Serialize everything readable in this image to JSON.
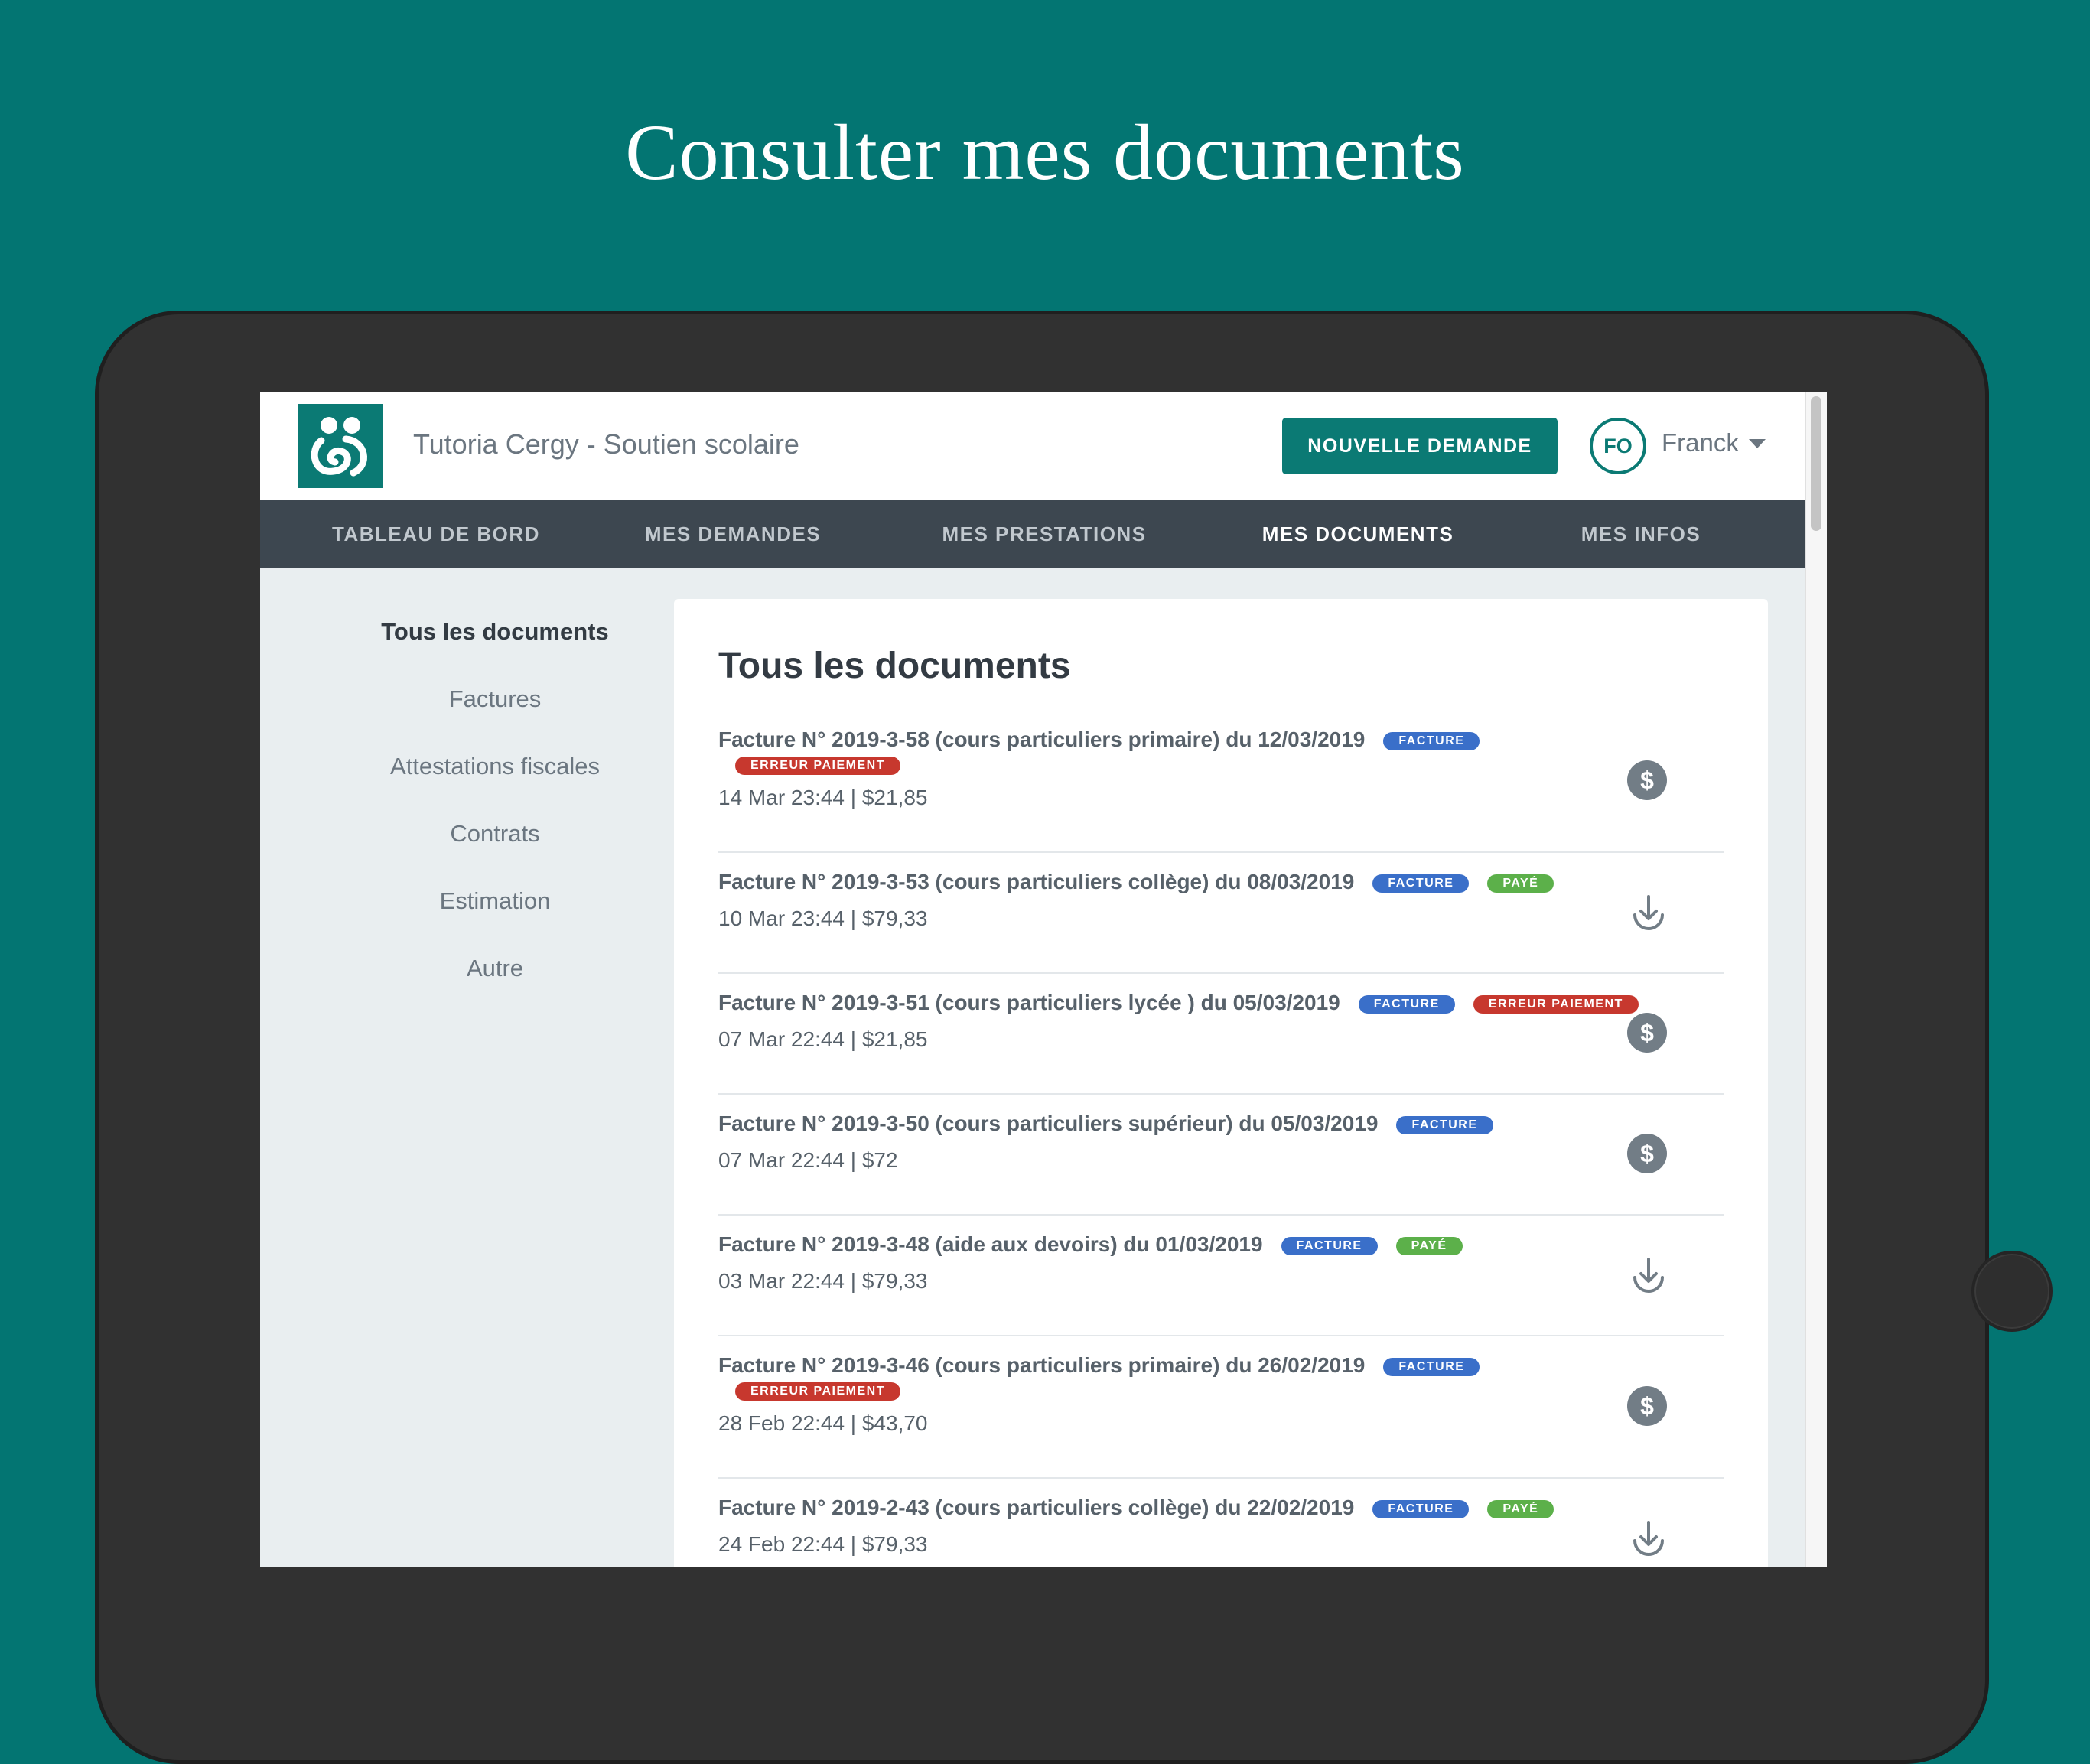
{
  "headline": "Consulter mes documents",
  "header": {
    "app_title": "Tutoria Cergy - Soutien scolaire",
    "new_request_label": "NOUVELLE DEMANDE",
    "avatar_initials": "FO",
    "user_name": "Franck"
  },
  "nav": {
    "items": [
      "TABLEAU DE BORD",
      "MES DEMANDES",
      "MES PRESTATIONS",
      "MES DOCUMENTS",
      "MES INFOS"
    ],
    "active": "MES DOCUMENTS"
  },
  "sidebar": {
    "items": [
      "Tous les documents",
      "Factures",
      "Attestations fiscales",
      "Contrats",
      "Estimation",
      "Autre"
    ],
    "active": "Tous les documents"
  },
  "main": {
    "title": "Tous les documents",
    "documents": [
      {
        "title": "Facture N° 2019-3-58 (cours particuliers primaire) du 12/03/2019",
        "badges": [
          {
            "label": "FACTURE",
            "color": "blue"
          }
        ],
        "badges_line2": [
          {
            "label": "ERREUR PAIEMENT",
            "color": "red"
          }
        ],
        "meta": "14 Mar 23:44 | $21,85",
        "action": "pay",
        "icon": "dollar-icon"
      },
      {
        "title": "Facture N° 2019-3-53 (cours particuliers collège) du 08/03/2019",
        "badges": [
          {
            "label": "FACTURE",
            "color": "blue"
          },
          {
            "label": "PAYÉ",
            "color": "green"
          }
        ],
        "badges_line2": [],
        "meta": "10 Mar 23:44 | $79,33",
        "action": "download",
        "icon": "download-icon"
      },
      {
        "title": "Facture N° 2019-3-51 (cours particuliers lycée ) du 05/03/2019",
        "badges": [
          {
            "label": "FACTURE",
            "color": "blue"
          },
          {
            "label": "ERREUR PAIEMENT",
            "color": "red"
          }
        ],
        "badges_line2": [],
        "meta": "07 Mar 22:44 | $21,85",
        "action": "pay",
        "icon": "dollar-icon"
      },
      {
        "title": "Facture N° 2019-3-50 (cours particuliers supérieur) du 05/03/2019",
        "badges": [
          {
            "label": "FACTURE",
            "color": "blue"
          }
        ],
        "badges_line2": [],
        "meta": "07 Mar 22:44 | $72",
        "action": "pay",
        "icon": "dollar-icon"
      },
      {
        "title": "Facture N° 2019-3-48 (aide aux devoirs) du 01/03/2019",
        "badges": [
          {
            "label": "FACTURE",
            "color": "blue"
          },
          {
            "label": "PAYÉ",
            "color": "green"
          }
        ],
        "badges_line2": [],
        "meta": "03 Mar 22:44 | $79,33",
        "action": "download",
        "icon": "download-icon"
      },
      {
        "title": "Facture N° 2019-3-46 (cours particuliers primaire) du 26/02/2019",
        "badges": [
          {
            "label": "FACTURE",
            "color": "blue"
          }
        ],
        "badges_line2": [
          {
            "label": "ERREUR PAIEMENT",
            "color": "red"
          }
        ],
        "meta": "28 Feb 22:44 | $43,70",
        "action": "pay",
        "icon": "dollar-icon"
      },
      {
        "title": "Facture N° 2019-2-43 (cours particuliers collège) du 22/02/2019",
        "badges": [
          {
            "label": "FACTURE",
            "color": "blue"
          },
          {
            "label": "PAYÉ",
            "color": "green"
          }
        ],
        "badges_line2": [],
        "meta": "24 Feb 22:44 | $79,33",
        "action": "download",
        "icon": "download-icon"
      }
    ]
  },
  "colors": {
    "background": "#037572",
    "brand": "#0b7a74",
    "nav": "#3d4750",
    "badge_blue": "#3a6fc9",
    "badge_green": "#5cb04a",
    "badge_red": "#c7382e"
  }
}
